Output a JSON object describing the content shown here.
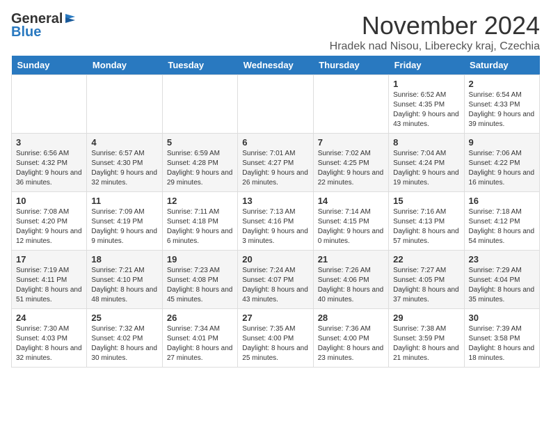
{
  "header": {
    "logo_general": "General",
    "logo_blue": "Blue",
    "month_title": "November 2024",
    "subtitle": "Hradek nad Nisou, Liberecky kraj, Czechia"
  },
  "days_of_week": [
    "Sunday",
    "Monday",
    "Tuesday",
    "Wednesday",
    "Thursday",
    "Friday",
    "Saturday"
  ],
  "weeks": [
    [
      {
        "day": "",
        "info": ""
      },
      {
        "day": "",
        "info": ""
      },
      {
        "day": "",
        "info": ""
      },
      {
        "day": "",
        "info": ""
      },
      {
        "day": "",
        "info": ""
      },
      {
        "day": "1",
        "info": "Sunrise: 6:52 AM\nSunset: 4:35 PM\nDaylight: 9 hours and 43 minutes."
      },
      {
        "day": "2",
        "info": "Sunrise: 6:54 AM\nSunset: 4:33 PM\nDaylight: 9 hours and 39 minutes."
      }
    ],
    [
      {
        "day": "3",
        "info": "Sunrise: 6:56 AM\nSunset: 4:32 PM\nDaylight: 9 hours and 36 minutes."
      },
      {
        "day": "4",
        "info": "Sunrise: 6:57 AM\nSunset: 4:30 PM\nDaylight: 9 hours and 32 minutes."
      },
      {
        "day": "5",
        "info": "Sunrise: 6:59 AM\nSunset: 4:28 PM\nDaylight: 9 hours and 29 minutes."
      },
      {
        "day": "6",
        "info": "Sunrise: 7:01 AM\nSunset: 4:27 PM\nDaylight: 9 hours and 26 minutes."
      },
      {
        "day": "7",
        "info": "Sunrise: 7:02 AM\nSunset: 4:25 PM\nDaylight: 9 hours and 22 minutes."
      },
      {
        "day": "8",
        "info": "Sunrise: 7:04 AM\nSunset: 4:24 PM\nDaylight: 9 hours and 19 minutes."
      },
      {
        "day": "9",
        "info": "Sunrise: 7:06 AM\nSunset: 4:22 PM\nDaylight: 9 hours and 16 minutes."
      }
    ],
    [
      {
        "day": "10",
        "info": "Sunrise: 7:08 AM\nSunset: 4:20 PM\nDaylight: 9 hours and 12 minutes."
      },
      {
        "day": "11",
        "info": "Sunrise: 7:09 AM\nSunset: 4:19 PM\nDaylight: 9 hours and 9 minutes."
      },
      {
        "day": "12",
        "info": "Sunrise: 7:11 AM\nSunset: 4:18 PM\nDaylight: 9 hours and 6 minutes."
      },
      {
        "day": "13",
        "info": "Sunrise: 7:13 AM\nSunset: 4:16 PM\nDaylight: 9 hours and 3 minutes."
      },
      {
        "day": "14",
        "info": "Sunrise: 7:14 AM\nSunset: 4:15 PM\nDaylight: 9 hours and 0 minutes."
      },
      {
        "day": "15",
        "info": "Sunrise: 7:16 AM\nSunset: 4:13 PM\nDaylight: 8 hours and 57 minutes."
      },
      {
        "day": "16",
        "info": "Sunrise: 7:18 AM\nSunset: 4:12 PM\nDaylight: 8 hours and 54 minutes."
      }
    ],
    [
      {
        "day": "17",
        "info": "Sunrise: 7:19 AM\nSunset: 4:11 PM\nDaylight: 8 hours and 51 minutes."
      },
      {
        "day": "18",
        "info": "Sunrise: 7:21 AM\nSunset: 4:10 PM\nDaylight: 8 hours and 48 minutes."
      },
      {
        "day": "19",
        "info": "Sunrise: 7:23 AM\nSunset: 4:08 PM\nDaylight: 8 hours and 45 minutes."
      },
      {
        "day": "20",
        "info": "Sunrise: 7:24 AM\nSunset: 4:07 PM\nDaylight: 8 hours and 43 minutes."
      },
      {
        "day": "21",
        "info": "Sunrise: 7:26 AM\nSunset: 4:06 PM\nDaylight: 8 hours and 40 minutes."
      },
      {
        "day": "22",
        "info": "Sunrise: 7:27 AM\nSunset: 4:05 PM\nDaylight: 8 hours and 37 minutes."
      },
      {
        "day": "23",
        "info": "Sunrise: 7:29 AM\nSunset: 4:04 PM\nDaylight: 8 hours and 35 minutes."
      }
    ],
    [
      {
        "day": "24",
        "info": "Sunrise: 7:30 AM\nSunset: 4:03 PM\nDaylight: 8 hours and 32 minutes."
      },
      {
        "day": "25",
        "info": "Sunrise: 7:32 AM\nSunset: 4:02 PM\nDaylight: 8 hours and 30 minutes."
      },
      {
        "day": "26",
        "info": "Sunrise: 7:34 AM\nSunset: 4:01 PM\nDaylight: 8 hours and 27 minutes."
      },
      {
        "day": "27",
        "info": "Sunrise: 7:35 AM\nSunset: 4:00 PM\nDaylight: 8 hours and 25 minutes."
      },
      {
        "day": "28",
        "info": "Sunrise: 7:36 AM\nSunset: 4:00 PM\nDaylight: 8 hours and 23 minutes."
      },
      {
        "day": "29",
        "info": "Sunrise: 7:38 AM\nSunset: 3:59 PM\nDaylight: 8 hours and 21 minutes."
      },
      {
        "day": "30",
        "info": "Sunrise: 7:39 AM\nSunset: 3:58 PM\nDaylight: 8 hours and 18 minutes."
      }
    ]
  ]
}
